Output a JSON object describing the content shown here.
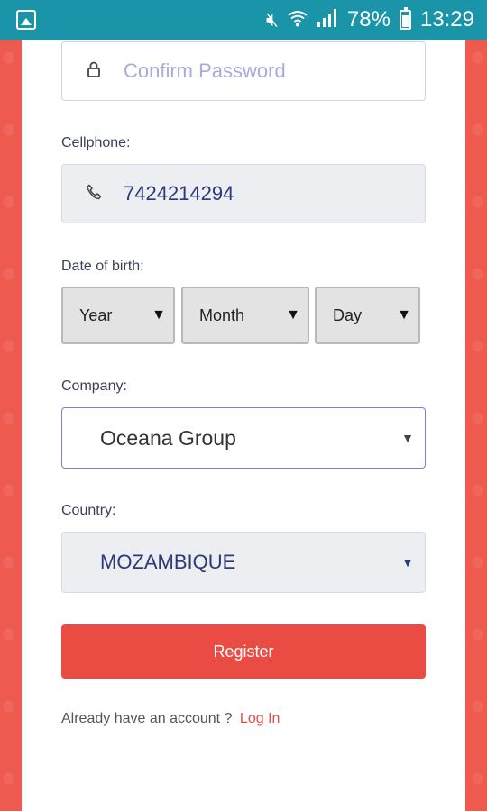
{
  "status_bar": {
    "battery": "78%",
    "time": "13:29",
    "icons": [
      "gallery-icon",
      "mute-icon",
      "wifi-icon",
      "signal-icon",
      "battery-icon"
    ]
  },
  "form": {
    "confirm_password": {
      "placeholder": "Confirm Password",
      "icon": "lock-icon"
    },
    "cellphone": {
      "label": "Cellphone:",
      "value": "7424214294",
      "icon": "phone-icon"
    },
    "date_of_birth": {
      "label": "Date of birth:",
      "year": "Year",
      "month": "Month",
      "day": "Day"
    },
    "company": {
      "label": "Company:",
      "value": "Oceana Group"
    },
    "country": {
      "label": "Country:",
      "value": "MOZAMBIQUE"
    },
    "register_label": "Register",
    "footer": {
      "text": "Already have an account ?",
      "link": "Log In"
    }
  },
  "colors": {
    "status_bar": "#1a94a8",
    "accent": "#ea4b43",
    "field_text": "#2e3a78",
    "placeholder": "#a7acde"
  }
}
